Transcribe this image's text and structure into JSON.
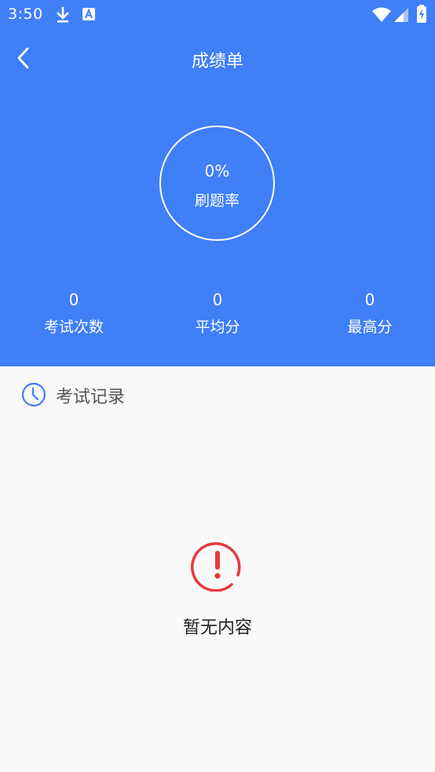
{
  "status_bar": {
    "time": "3:50",
    "icons": [
      "download-icon",
      "a-notification-icon",
      "wifi-icon",
      "signal-icon",
      "battery-charging-icon"
    ]
  },
  "app_bar": {
    "title": "成绩单",
    "back_icon": "back-arrow-icon"
  },
  "progress": {
    "value": "0%",
    "label": "刷题率",
    "fraction": 0
  },
  "stats": [
    {
      "value": "0",
      "label": "考试次数"
    },
    {
      "value": "0",
      "label": "平均分"
    },
    {
      "value": "0",
      "label": "最高分"
    }
  ],
  "records": {
    "title": "考试记录",
    "icon": "clock-icon"
  },
  "empty_state": {
    "text": "暂无内容",
    "icon": "alert-icon"
  },
  "colors": {
    "primary": "#3f7ff7",
    "background": "#f9f9f9",
    "alert": "#e8393b"
  }
}
